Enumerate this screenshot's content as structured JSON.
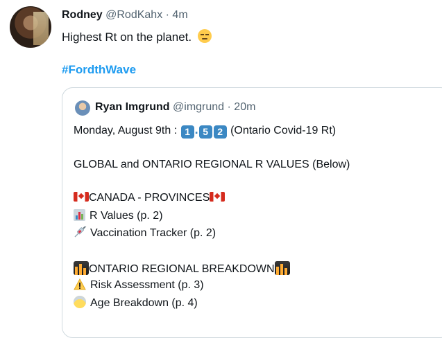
{
  "tweet": {
    "display_name": "Rodney",
    "handle": "@RodKahx",
    "separator": "·",
    "time": "4m",
    "text": "Highest Rt on the planet.",
    "emoji": "unamused-face-icon",
    "hashtag": "#FordthWave"
  },
  "quoted": {
    "display_name": "Ryan Imgrund",
    "handle": "@imgrund",
    "separator": "·",
    "time": "20m",
    "date_prefix": "Monday, August 9th :",
    "rt_digits": [
      "1",
      ".",
      "5",
      "2"
    ],
    "rt_suffix": "(Ontario Covid-19 Rt)",
    "global_line": "GLOBAL and ONTARIO REGIONAL R VALUES (Below)",
    "canada_heading": "CANADA - PROVINCES",
    "canada_items": [
      "R Values (p. 2)",
      "Vaccination Tracker (p. 2)"
    ],
    "ontario_heading": "ONTARIO REGIONAL BREAKDOWN",
    "ontario_items": [
      "Risk Assessment (p. 3)",
      "Age Breakdown (p. 4)"
    ]
  },
  "colors": {
    "link": "#1d9bf0",
    "keycap": "#3b88c3",
    "border": "#cfd9de",
    "muted": "#536471"
  }
}
